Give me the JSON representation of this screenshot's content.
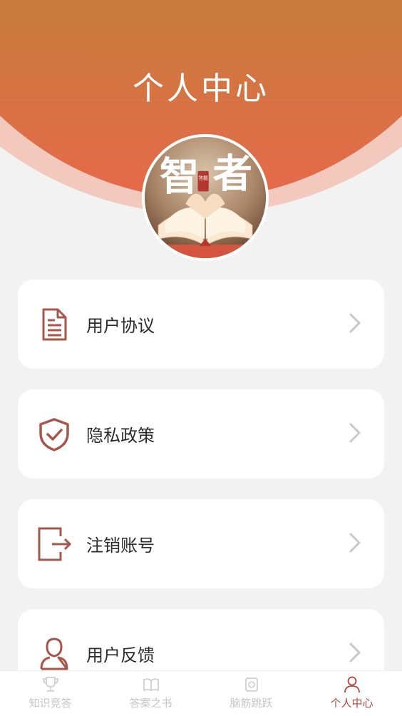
{
  "header": {
    "title": "个人中心"
  },
  "avatar": {
    "text_left": "智",
    "text_right": "者",
    "seal": "答题"
  },
  "menu": {
    "items": [
      {
        "label": "用户协议",
        "icon": "document-icon"
      },
      {
        "label": "隐私政策",
        "icon": "shield-check-icon"
      },
      {
        "label": "注销账号",
        "icon": "logout-icon"
      },
      {
        "label": "用户反馈",
        "icon": "user-icon"
      }
    ]
  },
  "tabbar": {
    "tabs": [
      {
        "label": "知识竞答",
        "icon": "trophy-icon",
        "active": false
      },
      {
        "label": "答案之书",
        "icon": "book-icon",
        "active": false
      },
      {
        "label": "脑筋跳跃",
        "icon": "puzzle-icon",
        "active": false
      },
      {
        "label": "个人中心",
        "icon": "person-icon",
        "active": true
      }
    ]
  },
  "colors": {
    "accent": "#b7443a",
    "header_top": "#c77d3d",
    "header_bottom": "#e6694a",
    "icon": "#a8554a"
  }
}
